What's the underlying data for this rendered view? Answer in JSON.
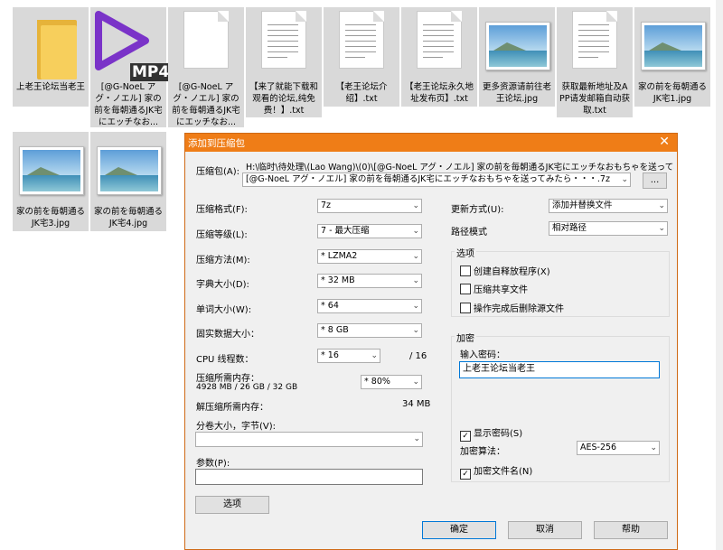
{
  "files": [
    {
      "name": "上老王论坛当老王",
      "kind": "folder"
    },
    {
      "name": "[@G-NoeL アグ・ノエル] 家の前を毎朝通るJK宅にエッチなお...",
      "kind": "mp4",
      "tag": "MP4"
    },
    {
      "name": "[@G-NoeL アグ・ノエル] 家の前を毎朝通るJK宅にエッチなお...",
      "kind": "doc"
    },
    {
      "name": "【来了就能下载和观看的论坛,纯免费！】.txt",
      "kind": "txt"
    },
    {
      "name": "【老王论坛介绍】.txt",
      "kind": "txt"
    },
    {
      "name": "【老王论坛永久地址发布页】.txt",
      "kind": "txt"
    },
    {
      "name": "更多资源请前往老王论坛.jpg",
      "kind": "jpg"
    },
    {
      "name": "获取最新地址及APP请发邮箱自动获取.txt",
      "kind": "txt"
    },
    {
      "name": "家の前を毎朝通るJK宅1.jpg",
      "kind": "jpg"
    },
    {
      "name": "家の前を毎朝通るJK宅3.jpg",
      "kind": "jpg"
    },
    {
      "name": "家の前を毎朝通るJK宅4.jpg",
      "kind": "jpg"
    }
  ],
  "dialog": {
    "title": "添加到压缩包",
    "close": "✕",
    "archive_label": "压缩包(A):",
    "archive_dir": "H:\\临时\\待处理\\(Lao Wang)\\(0)\\[@G-NoeL アグ・ノエル] 家の前を毎朝通るJK宅にエッチなおもちゃを送ってみ",
    "archive_name": "[@G-NoeL アグ・ノエル] 家の前を毎朝通るJK宅にエッチなおもちゃを送ってみたら・・・.7z",
    "browse": "...",
    "left": [
      {
        "label": "压缩格式(F):",
        "value": "7z"
      },
      {
        "label": "压缩等级(L):",
        "value": "7 - 最大压缩"
      },
      {
        "label": "压缩方法(M):",
        "value": "* LZMA2"
      },
      {
        "label": "字典大小(D):",
        "value": "* 32 MB"
      },
      {
        "label": "单词大小(W):",
        "value": "* 64"
      },
      {
        "label": "固实数据大小：",
        "value": "* 8 GB"
      }
    ],
    "cpu_label": "CPU 线程数：",
    "cpu_value": "* 16",
    "cpu_total": "/ 16",
    "mem_label": "压缩所需内存：",
    "mem_detail": "4928 MB / 26 GB / 32 GB",
    "mem_value": "* 80%",
    "demem_label": "解压缩所需内存：",
    "demem_value": "34 MB",
    "split_label": "分卷大小，字节(V):",
    "split_value": "",
    "params_label": "参数(P):",
    "params_value": "",
    "options_button": "选项",
    "update_label": "更新方式(U):",
    "update_value": "添加并替换文件",
    "path_label": "路径模式",
    "path_value": "相对路径",
    "options_group": "选项",
    "opt_sfx": "创建自释放程序(X)",
    "opt_shared": "压缩共享文件",
    "opt_delete": "操作完成后删除源文件",
    "enc_group": "加密",
    "pwd_label": "输入密码：",
    "pwd_value": "上老王论坛当老王",
    "show_pwd": "显示密码(S)",
    "enc_method_label": "加密算法：",
    "enc_method_value": "AES-256",
    "enc_names": "加密文件名(N)",
    "ok": "确定",
    "cancel": "取消",
    "help": "帮助",
    "check_mark": "✓",
    "arrow": "⌄"
  }
}
